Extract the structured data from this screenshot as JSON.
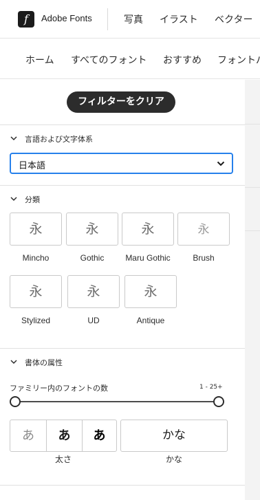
{
  "header": {
    "logo_glyph": "f",
    "brand": "Adobe Fonts",
    "links": [
      "写真",
      "イラスト",
      "ベクター"
    ]
  },
  "subnav": {
    "links": [
      "ホーム",
      "すべてのフォント",
      "おすすめ",
      "フォントパ"
    ]
  },
  "filters": {
    "clear_label": "フィルターをクリア",
    "language": {
      "title": "言語および文字体系",
      "selected": "日本語"
    },
    "classification": {
      "title": "分類",
      "sample_glyph": "永",
      "items": [
        "Mincho",
        "Gothic",
        "Maru Gothic",
        "Brush",
        "Stylized",
        "UD",
        "Antique"
      ]
    },
    "properties": {
      "title": "書体の属性",
      "family_count_label": "ファミリー内のフォントの数",
      "family_count_range": "1 - 25+",
      "family_count_min": 1,
      "family_count_max": 25,
      "weight_samples": [
        "あ",
        "あ",
        "あ"
      ],
      "weight_label": "太さ",
      "kana_sample": "かな",
      "kana_label": "かな"
    }
  },
  "colors": {
    "accent": "#2680eb",
    "button_dark": "#2c2c2c"
  }
}
